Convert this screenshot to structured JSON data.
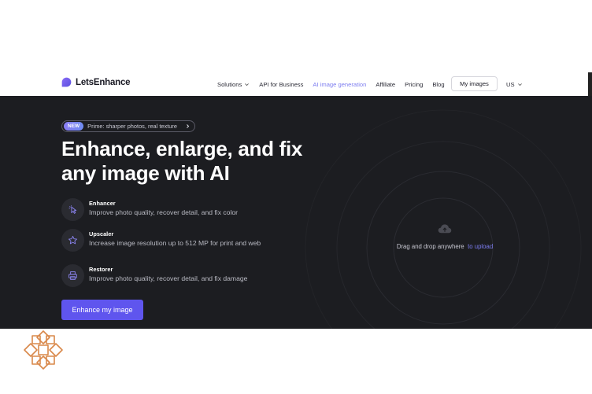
{
  "nav": {
    "brand": "LetsEnhance",
    "items": [
      {
        "label": "Solutions",
        "has_dropdown": true
      },
      {
        "label": "API for Business"
      },
      {
        "label": "AI image generation",
        "accent": true
      },
      {
        "label": "Affiliate"
      },
      {
        "label": "Pricing"
      },
      {
        "label": "Blog"
      }
    ],
    "my_images": "My images",
    "language": "US"
  },
  "hero": {
    "promo_badge": "NEW",
    "promo_text": "Prime: sharper photos, real texture",
    "headline_line1": "Enhance, enlarge, and fix",
    "headline_line2": "any image with AI",
    "features": [
      {
        "title": "Enhancer",
        "desc": "Improve photo quality, recover detail, and fix color",
        "icon": "pointer-sparkle-icon"
      },
      {
        "title": "Upscaler",
        "desc": "Increase image resolution up to 512 MP for print and web",
        "icon": "star-upscale-icon"
      },
      {
        "title": "Restorer",
        "desc": "Improve photo quality, recover detail, and fix damage",
        "icon": "printer-restore-icon"
      }
    ],
    "cta": "Enhance my image",
    "drop_text": "Drag and drop anywhere",
    "drop_link": "to upload"
  },
  "colors": {
    "accent": "#5f55ee",
    "link": "#7c7cf0",
    "hero_bg": "#1c1d21",
    "deco": "#d9884a"
  }
}
